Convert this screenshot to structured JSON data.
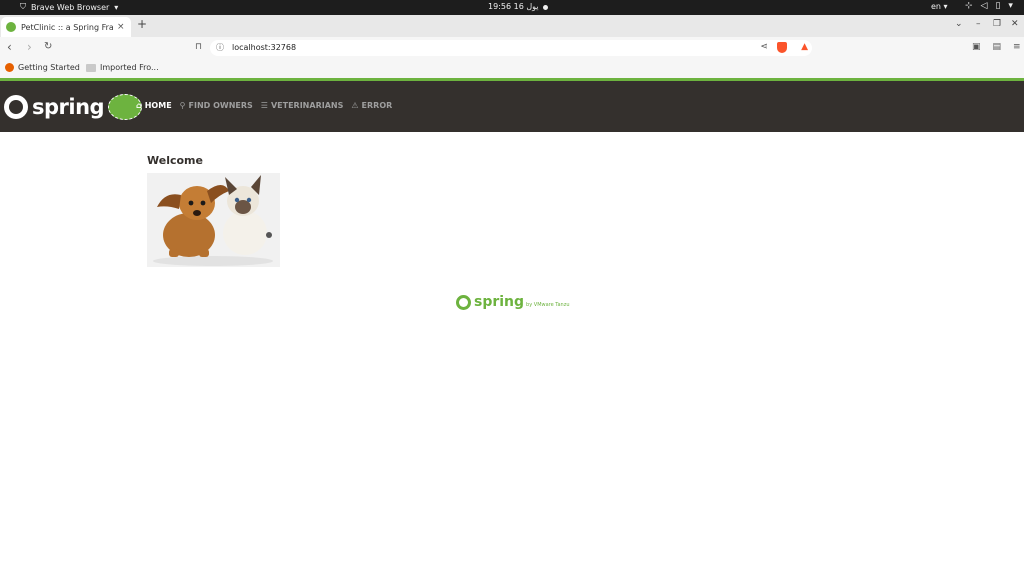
{
  "os": {
    "app_name": "Brave Web Browser",
    "clock": "19:56  16 يول",
    "lang": "en"
  },
  "browser": {
    "tab_title": "PetClinic :: a Spring Framework",
    "close_glyph": "×",
    "new_tab_glyph": "+",
    "url": "localhost:32768",
    "bookmarks": [
      "Getting Started",
      "Imported Fro..."
    ]
  },
  "site": {
    "brand": "spring",
    "nav": [
      {
        "label": "HOME",
        "icon": "home-icon",
        "active": true
      },
      {
        "label": "FIND OWNERS",
        "icon": "search-icon",
        "active": false
      },
      {
        "label": "VETERINARIANS",
        "icon": "list-icon",
        "active": false
      },
      {
        "label": "ERROR",
        "icon": "warning-icon",
        "active": false
      }
    ],
    "heading": "Welcome",
    "footer_brand": "spring",
    "footer_by": "by VMware Tanzu"
  },
  "colors": {
    "nav_bg": "#34302d",
    "accent": "#6db33f"
  }
}
